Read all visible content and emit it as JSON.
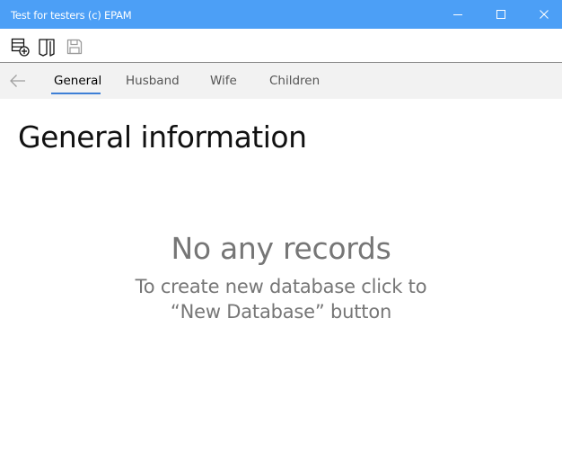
{
  "window": {
    "title": "Test for testers (c) EPAM",
    "controls": [
      "minimize-icon",
      "maximize-icon",
      "close-icon"
    ],
    "titlebar_color": "#4c9ff6"
  },
  "toolbar": {
    "buttons": [
      {
        "name": "new-database",
        "icon": "database-add-icon"
      },
      {
        "name": "open-database",
        "icon": "open-book-icon"
      },
      {
        "name": "save-database",
        "icon": "save-icon",
        "enabled": false
      }
    ]
  },
  "nav": {
    "back_icon": "back-arrow-icon",
    "tabs": [
      {
        "label": "General",
        "active": true
      },
      {
        "label": "Husband",
        "active": false
      },
      {
        "label": "Wife",
        "active": false
      },
      {
        "label": "Children",
        "active": false
      }
    ],
    "accent_color": "#3d7fd6"
  },
  "main": {
    "page_title": "General information",
    "empty_title": "No any records",
    "empty_hint": "To create new database click to “New Database” button"
  }
}
